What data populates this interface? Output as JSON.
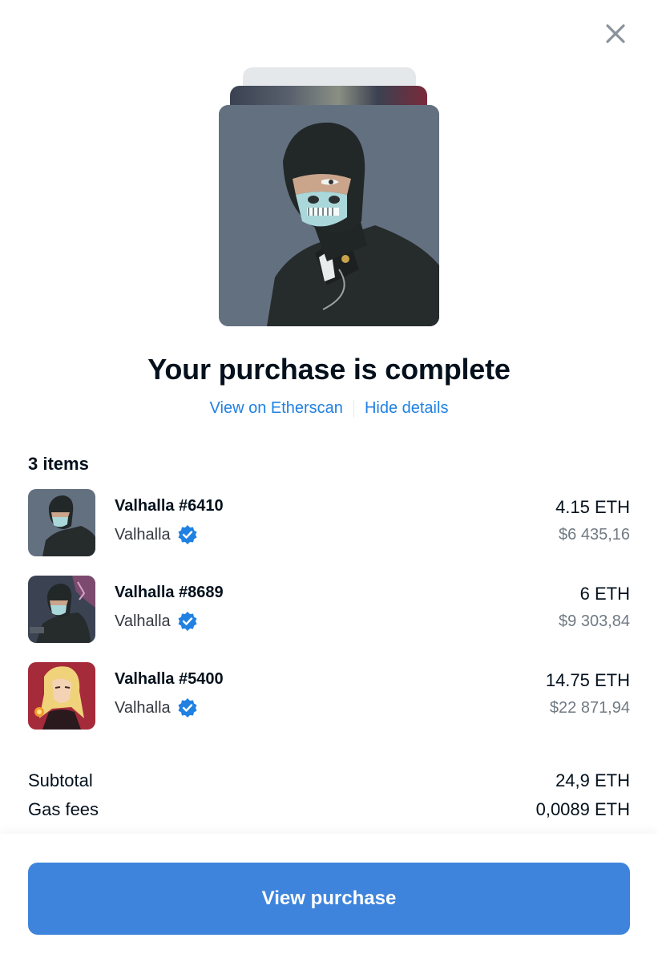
{
  "modal": {
    "title": "Your purchase is complete",
    "links": {
      "etherscan": "View on Etherscan",
      "hide": "Hide details"
    },
    "items_count": "3 items"
  },
  "items": [
    {
      "name": "Valhalla #6410",
      "collection": "Valhalla",
      "price_eth": "4.15 ETH",
      "price_usd": "$6 435,16"
    },
    {
      "name": "Valhalla #8689",
      "collection": "Valhalla",
      "price_eth": "6 ETH",
      "price_usd": "$9 303,84"
    },
    {
      "name": "Valhalla #5400",
      "collection": "Valhalla",
      "price_eth": "14.75 ETH",
      "price_usd": "$22 871,94"
    }
  ],
  "summary": {
    "subtotal_label": "Subtotal",
    "subtotal_value": "24,9 ETH",
    "gas_label": "Gas fees",
    "gas_value": "0,0089 ETH"
  },
  "cta": {
    "label": "View purchase"
  },
  "colors": {
    "accent": "#2081e2",
    "button": "#3e84dc",
    "muted": "#707a83",
    "verified": "#2081e2"
  },
  "icons": {
    "close": "close-icon",
    "verified": "verified-badge-icon"
  }
}
